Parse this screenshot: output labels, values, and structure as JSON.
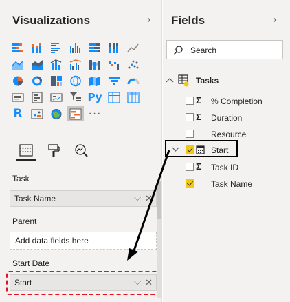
{
  "visualizations": {
    "title": "Visualizations",
    "icons": [
      "stacked-bar-chart-icon",
      "stacked-column-chart-icon",
      "clustered-bar-chart-icon",
      "clustered-column-chart-icon",
      "100-stacked-bar-chart-icon",
      "100-stacked-column-chart-icon",
      "line-chart-icon",
      "area-chart-icon",
      "stacked-area-chart-icon",
      "line-and-column-chart-icon",
      "line-and-clustered-column-chart-icon",
      "ribbon-chart-icon",
      "waterfall-chart-icon",
      "scatter-chart-icon",
      "pie-chart-icon",
      "donut-chart-icon",
      "treemap-icon",
      "map-icon",
      "filled-map-icon",
      "funnel-icon",
      "gauge-icon",
      "card-icon",
      "multi-row-card-icon",
      "kpi-icon",
      "slicer-icon",
      "python-visual-icon",
      "table-icon",
      "matrix-icon",
      "r-visual-icon",
      "key-influencers-icon",
      "arcgis-map-icon",
      "gantt-chart-icon"
    ],
    "more_glyph": "···",
    "tabs": [
      "fields-tab-icon",
      "format-tab-icon",
      "analytics-tab-icon"
    ],
    "wells": {
      "task": {
        "label": "Task",
        "value": "Task Name"
      },
      "parent": {
        "label": "Parent",
        "placeholder": "Add data fields here"
      },
      "start_date": {
        "label": "Start Date",
        "value": "Start"
      }
    },
    "well_chevron": "⌵",
    "well_remove": "✕"
  },
  "fields": {
    "title": "Fields",
    "chevron": "›",
    "search_placeholder": "Search",
    "table_name": "Tasks",
    "items": [
      {
        "name": "% Completion",
        "checked": false,
        "icon": "sigma"
      },
      {
        "name": "Duration",
        "checked": false,
        "icon": "sigma"
      },
      {
        "name": "Resource",
        "checked": false,
        "icon": ""
      },
      {
        "name": "Start",
        "checked": true,
        "icon": "calendar"
      },
      {
        "name": "Task ID",
        "checked": false,
        "icon": "sigma"
      },
      {
        "name": "Task Name",
        "checked": true,
        "icon": ""
      }
    ],
    "sigma_glyph": "Σ"
  },
  "colors": {
    "accent_yellow": "#f2c811",
    "highlight_red": "#e81123",
    "highlight_black": "#000000"
  }
}
